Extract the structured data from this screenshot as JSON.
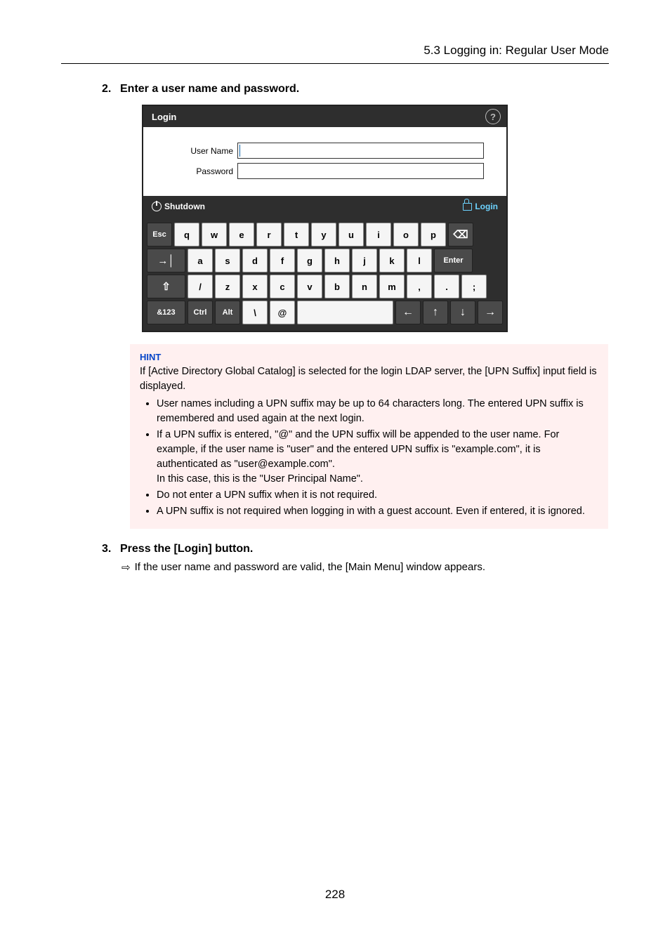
{
  "header": {
    "section": "5.3 Logging in: Regular User Mode"
  },
  "step2": {
    "num": "2.",
    "text": "Enter a user name and password."
  },
  "login_shot": {
    "title": "Login",
    "labels": {
      "username": "User Name",
      "password": "Password"
    },
    "buttons": {
      "shutdown": "Shutdown",
      "login": "Login"
    },
    "keyboard": {
      "row1": [
        "Esc",
        "q",
        "w",
        "e",
        "r",
        "t",
        "y",
        "u",
        "i",
        "o",
        "p",
        "⌫"
      ],
      "row2_lead": "→│",
      "row2": [
        "a",
        "s",
        "d",
        "f",
        "g",
        "h",
        "j",
        "k",
        "l"
      ],
      "row2_enter": "Enter",
      "row3_shift": "⇧",
      "row3": [
        "/",
        "z",
        "x",
        "c",
        "v",
        "b",
        "n",
        "m",
        ",",
        ".",
        ";"
      ],
      "row4": {
        "num": "&123",
        "ctrl": "Ctrl",
        "alt": "Alt",
        "bslash": "\\",
        "at": "@",
        "left": "←",
        "up": "↑",
        "down": "↓",
        "right": "→"
      }
    }
  },
  "hint": {
    "label": "HINT",
    "intro": "If [Active Directory Global Catalog] is selected for the login LDAP server, the [UPN Suffix] input field is displayed.",
    "items": [
      "User names including a UPN suffix may be up to 64 characters long. The entered UPN suffix is remembered and used again at the next login.",
      "If a UPN suffix is entered, \"@\" and the UPN suffix will be appended to the user name. For example, if the user name is \"user\" and the entered UPN suffix is \"example.com\", it is authenticated as \"user@example.com\".\nIn this case, this is the \"User Principal Name\".",
      "Do not enter a UPN suffix when it is not required.",
      "A UPN suffix is not required when logging in with a guest account. Even if entered, it is ignored."
    ]
  },
  "step3": {
    "num": "3.",
    "text": "Press the [Login] button.",
    "result": "If the user name and password are valid, the [Main Menu] window appears."
  },
  "page_number": "228"
}
